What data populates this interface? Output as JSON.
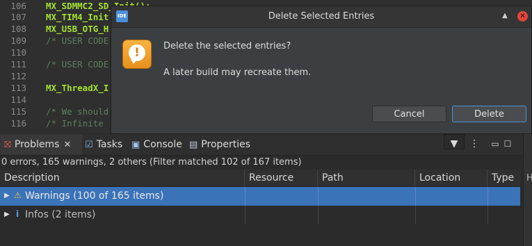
{
  "editor": {
    "lines": [
      {
        "num": "106",
        "text": "MX_SDMMC2_SD_Init();",
        "kind": "green"
      },
      {
        "num": "107",
        "text": "MX_TIM4_Init",
        "kind": "green"
      },
      {
        "num": "108",
        "text": "MX_USB_OTG_H",
        "kind": "green"
      },
      {
        "num": "109",
        "text": "/* USER CODE",
        "kind": "comment"
      },
      {
        "num": "110",
        "text": "",
        "kind": "blank"
      },
      {
        "num": "111",
        "text": "/* USER CODE",
        "kind": "comment"
      },
      {
        "num": "112",
        "text": "",
        "kind": "blank"
      },
      {
        "num": "113",
        "text": "MX_ThreadX_I",
        "kind": "green"
      },
      {
        "num": "114",
        "text": "",
        "kind": "blank"
      },
      {
        "num": "115",
        "text": "/* We should",
        "kind": "comment"
      },
      {
        "num": "116",
        "text": "/* Infinite ",
        "kind": "comment"
      }
    ]
  },
  "dialog": {
    "title": "Delete Selected Entries",
    "app_icon_text": "IDE",
    "icon": "warning-icon",
    "message_primary": "Delete the selected entries?",
    "message_secondary": "A later build may recreate them.",
    "cancel_label": "Cancel",
    "delete_label": "Delete",
    "accent_color": "#4b8fd6"
  },
  "panel": {
    "tabs": [
      {
        "label": "Problems",
        "icon": "problems-icon",
        "active": true
      },
      {
        "label": "Tasks",
        "icon": "tasks-icon"
      },
      {
        "label": "Console",
        "icon": "console-icon"
      },
      {
        "label": "Properties",
        "icon": "properties-icon"
      }
    ],
    "status": "0 errors, 165 warnings, 2 others (Filter matched 102 of 167 items)",
    "columns": [
      "Description",
      "Resource",
      "Path",
      "Location",
      "Type"
    ],
    "rows": [
      {
        "label": "Warnings (100 of 165 items)",
        "icon": "warning-icon",
        "selected": true
      },
      {
        "label": "Infos (2 items)",
        "icon": "info-icon",
        "selected": false
      }
    ],
    "selection_color": "#3b73b9"
  },
  "right_strip": {
    "letter": "H"
  }
}
